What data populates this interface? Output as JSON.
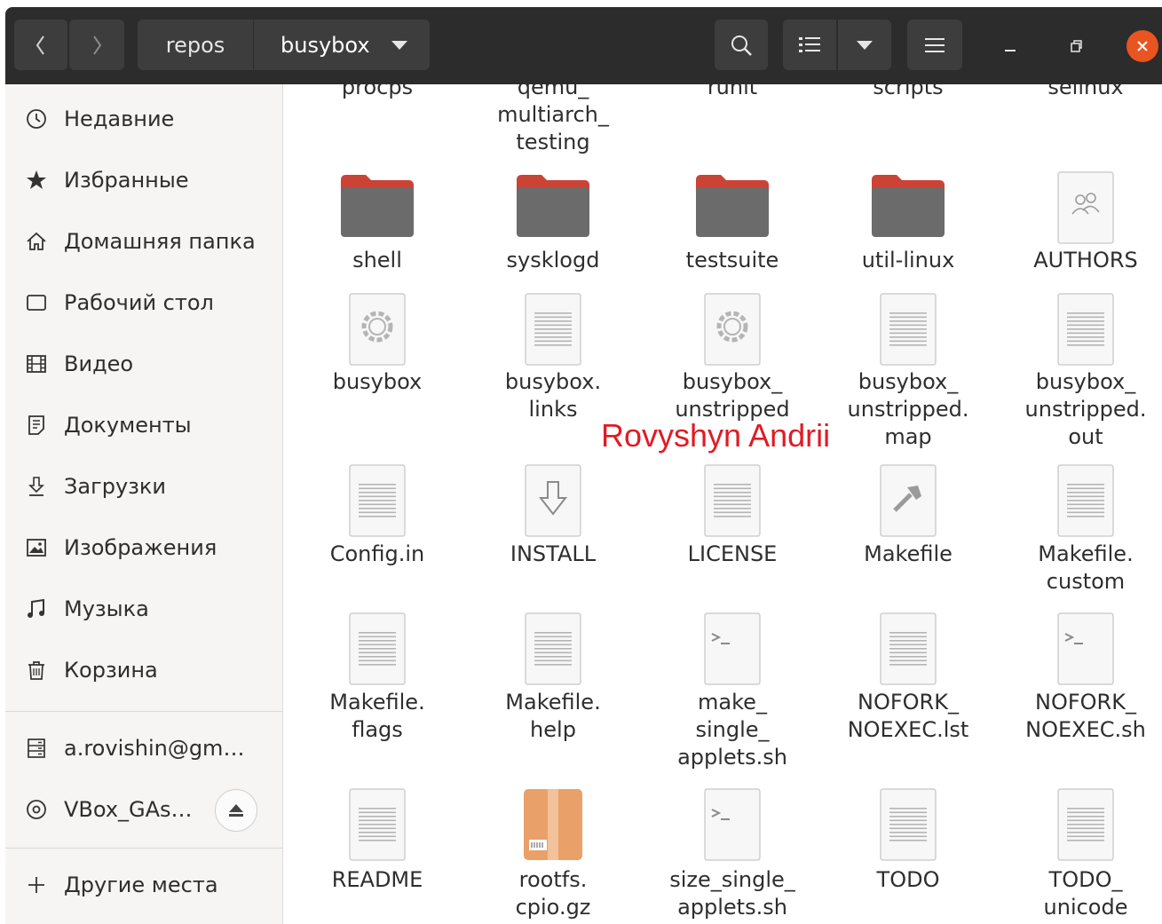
{
  "header": {
    "breadcrumbs": [
      "repos",
      "busybox"
    ]
  },
  "sidebar": {
    "items": [
      {
        "label": "Недавние",
        "icon": "clock-icon"
      },
      {
        "label": "Избранные",
        "icon": "star-icon"
      },
      {
        "label": "Домашняя папка",
        "icon": "home-icon"
      },
      {
        "label": "Рабочий стол",
        "icon": "desktop-icon"
      },
      {
        "label": "Видео",
        "icon": "film-icon"
      },
      {
        "label": "Документы",
        "icon": "document-icon"
      },
      {
        "label": "Загрузки",
        "icon": "download-icon"
      },
      {
        "label": "Изображения",
        "icon": "image-icon"
      },
      {
        "label": "Музыка",
        "icon": "music-icon"
      },
      {
        "label": "Корзина",
        "icon": "trash-icon"
      }
    ],
    "devices": [
      {
        "label": "a.rovishin@gm…",
        "icon": "network-drive-icon"
      },
      {
        "label": "VBox_GAs…",
        "icon": "disc-icon"
      }
    ],
    "other_places": {
      "label": "Другие места",
      "icon": "plus-icon"
    }
  },
  "files": [
    {
      "name": "procps",
      "type": "folder"
    },
    {
      "name": "qemu_\nmultiarch_\ntesting",
      "type": "folder"
    },
    {
      "name": "runit",
      "type": "folder"
    },
    {
      "name": "scripts",
      "type": "folder"
    },
    {
      "name": "selinux",
      "type": "folder"
    },
    {
      "name": "shell",
      "type": "folder"
    },
    {
      "name": "sysklogd",
      "type": "folder"
    },
    {
      "name": "testsuite",
      "type": "folder"
    },
    {
      "name": "util-linux",
      "type": "folder"
    },
    {
      "name": "AUTHORS",
      "type": "people"
    },
    {
      "name": "busybox",
      "type": "exec"
    },
    {
      "name": "busybox.\nlinks",
      "type": "text"
    },
    {
      "name": "busybox_\nunstripped",
      "type": "exec"
    },
    {
      "name": "busybox_\nunstripped.\nmap",
      "type": "text"
    },
    {
      "name": "busybox_\nunstripped.\nout",
      "type": "text"
    },
    {
      "name": "Config.in",
      "type": "text"
    },
    {
      "name": "INSTALL",
      "type": "install"
    },
    {
      "name": "LICENSE",
      "type": "text"
    },
    {
      "name": "Makefile",
      "type": "makefile"
    },
    {
      "name": "Makefile.\ncustom",
      "type": "text"
    },
    {
      "name": "Makefile.\nflags",
      "type": "text"
    },
    {
      "name": "Makefile.\nhelp",
      "type": "text"
    },
    {
      "name": "make_\nsingle_\napplets.sh",
      "type": "script"
    },
    {
      "name": "NOFORK_\nNOEXEC.lst",
      "type": "text"
    },
    {
      "name": "NOFORK_\nNOEXEC.sh",
      "type": "script"
    },
    {
      "name": "README",
      "type": "text"
    },
    {
      "name": "rootfs.\ncpio.gz",
      "type": "archive"
    },
    {
      "name": "size_single_\napplets.sh",
      "type": "script"
    },
    {
      "name": "TODO",
      "type": "text"
    },
    {
      "name": "TODO_\nunicode",
      "type": "text"
    }
  ],
  "watermark": "Rovyshyn Andrii",
  "colors": {
    "headerbar": "#2c2c2c",
    "close_button": "#e95420",
    "folder_tab": "#a7304f",
    "folder_body": "#6b6b6b",
    "watermark": "#e01b24"
  }
}
